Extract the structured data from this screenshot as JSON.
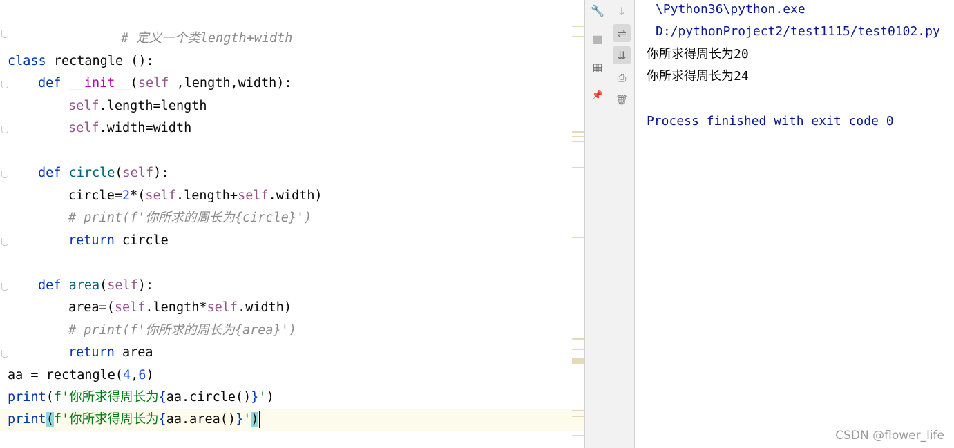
{
  "editor": {
    "lines": {
      "comment1": "# 定义一个类length+width",
      "class_kw": "class",
      "class_name": " rectangle ():",
      "def1_kw": "def",
      "init_name": "__init__",
      "init_open": "(",
      "init_self": "self",
      "init_args": " ,length,width):",
      "self_l": "self",
      "assign_l": ".length=length",
      "self_w": "self",
      "assign_w": ".width=width",
      "def2_kw": "def",
      "circle_name": "circle",
      "circle_open": "(",
      "circle_self": "self",
      "circle_close": "):",
      "circle_expr_a": "circle=",
      "circle_num": "2",
      "circle_expr_b": "*(",
      "circle_self1": "self",
      "circle_expr_c": ".length+",
      "circle_self2": "self",
      "circle_expr_d": ".width)",
      "comment2": "# print(f'你所求的周长为{circle}')",
      "return1_kw": "return",
      "return1_val": " circle",
      "def3_kw": "def",
      "area_name": "area",
      "area_open": "(",
      "area_self": "self",
      "area_close": "):",
      "area_expr_a": "area=(",
      "area_self1": "self",
      "area_expr_b": ".length*",
      "area_self2": "self",
      "area_expr_c": ".width)",
      "comment3": "# print(f'你所求的周长为{area}')",
      "return2_kw": "return",
      "return2_val": " area",
      "aa_a": "aa = rectangle(",
      "aa_n1": "4",
      "aa_comma": ",",
      "aa_n2": "6",
      "aa_close": ")",
      "print1_kw": "print",
      "print1_open": "(",
      "print1_str_a": "f'你所求得周长为",
      "print1_brace_o": "{",
      "print1_expr": "aa.circle()",
      "print1_brace_c": "}",
      "print1_str_b": "'",
      "print1_close": ")",
      "print2_kw": "print",
      "print2_open": "(",
      "print2_str_a": "f'你所求得周长为",
      "print2_brace_o": "{",
      "print2_expr": "aa.area()",
      "print2_brace_c": "}",
      "print2_str_b": "'",
      "print2_close": ")"
    }
  },
  "toolbar": {
    "wrench_icon": "🔧",
    "stop_icon": "■",
    "layout_icon": "▦",
    "pin_icon": "📌",
    "down_icon": "↓",
    "wrap_icon": "⇌",
    "scroll_end_icon": "⇊",
    "print_icon": "⎙",
    "trash_icon": "🗑"
  },
  "console": {
    "path1": "\\Python36\\python.exe",
    "path2": "D:/pythonProject2/test1115/test0102.py",
    "out1": "你所求得周长为20",
    "out2": "你所求得周长为24",
    "exit": "Process finished with exit code 0"
  },
  "watermark": "CSDN @flower_life",
  "colors": {
    "keyword": "#0033b3",
    "self": "#94558d",
    "string": "#067d17",
    "number": "#1750eb",
    "comment": "#8c8c8c",
    "console_path": "#0a1a8c"
  }
}
